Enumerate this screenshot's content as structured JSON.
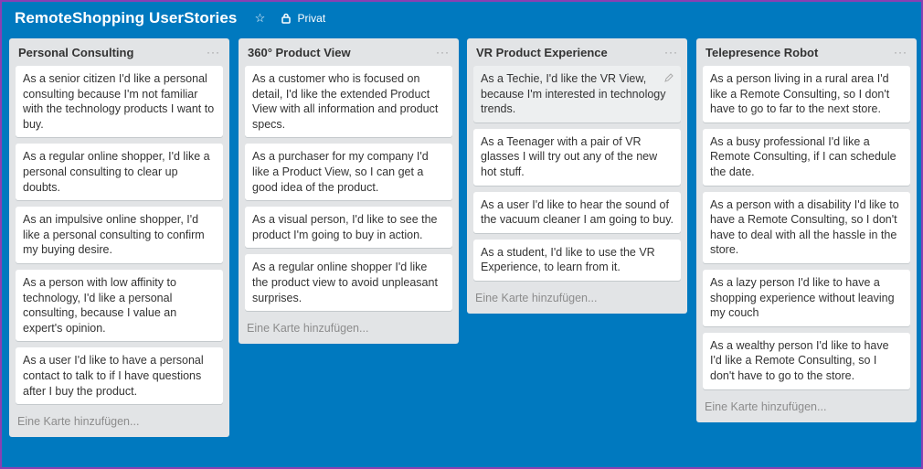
{
  "board": {
    "title": "RemoteShopping UserStories",
    "visibility": "Privat",
    "background_color": "#0079bf"
  },
  "icons": {
    "star": "star-icon",
    "lock": "lock-icon",
    "menu": "ellipsis-icon",
    "edit": "pencil-icon"
  },
  "add_card_label": "Eine Karte hinzufügen...",
  "lists": [
    {
      "title": "Personal Consulting",
      "cards": [
        "As a senior citizen I'd like a personal consulting because I'm not familiar with the technology products I want to buy.",
        "As a regular online shopper, I'd like a personal consulting to clear up doubts.",
        "As an impulsive online shopper, I'd like a personal consulting to confirm my buying desire.",
        "As a person with low affinity to technology, I'd like a personal consulting, because I value an expert's opinion.",
        "As a user I'd like to have a personal contact to talk to if I have questions after I buy the product."
      ]
    },
    {
      "title": "360° Product View",
      "cards": [
        "As a customer who is focused on detail, I'd like the extended Product View with all information and product specs.",
        "As a purchaser for my company I'd like a Product View, so I can get a good idea of the product.",
        "As a visual person, I'd like to see the product I'm going to buy in action.",
        "As a regular online shopper I'd like the product view to avoid unpleasant surprises."
      ]
    },
    {
      "title": "VR Product Experience",
      "cards": [
        "As a Techie, I'd like the VR View, because I'm interested in technology trends.",
        "As a Teenager with a pair of VR glasses I will try out any of the new hot stuff.",
        "As a user I'd like to hear the sound of the vacuum cleaner I am going to buy.",
        "As a student, I'd like to use the VR Experience, to learn from it."
      ]
    },
    {
      "title": "Telepresence Robot",
      "cards": [
        "As a person living in a rural area I'd like a Remote Consulting, so I don't have to go to far to the next store.",
        "As a busy professional I'd like a Remote Consulting, if I can schedule the date.",
        "As a person with a disability I'd like to have a Remote Consulting, so I don't have to deal with all the hassle in the store.",
        "As a lazy person I'd like to have a shopping experience without leaving my couch",
        "As a wealthy person I'd like to have I'd like a Remote Consulting, so I don't have to go to the store."
      ]
    }
  ]
}
